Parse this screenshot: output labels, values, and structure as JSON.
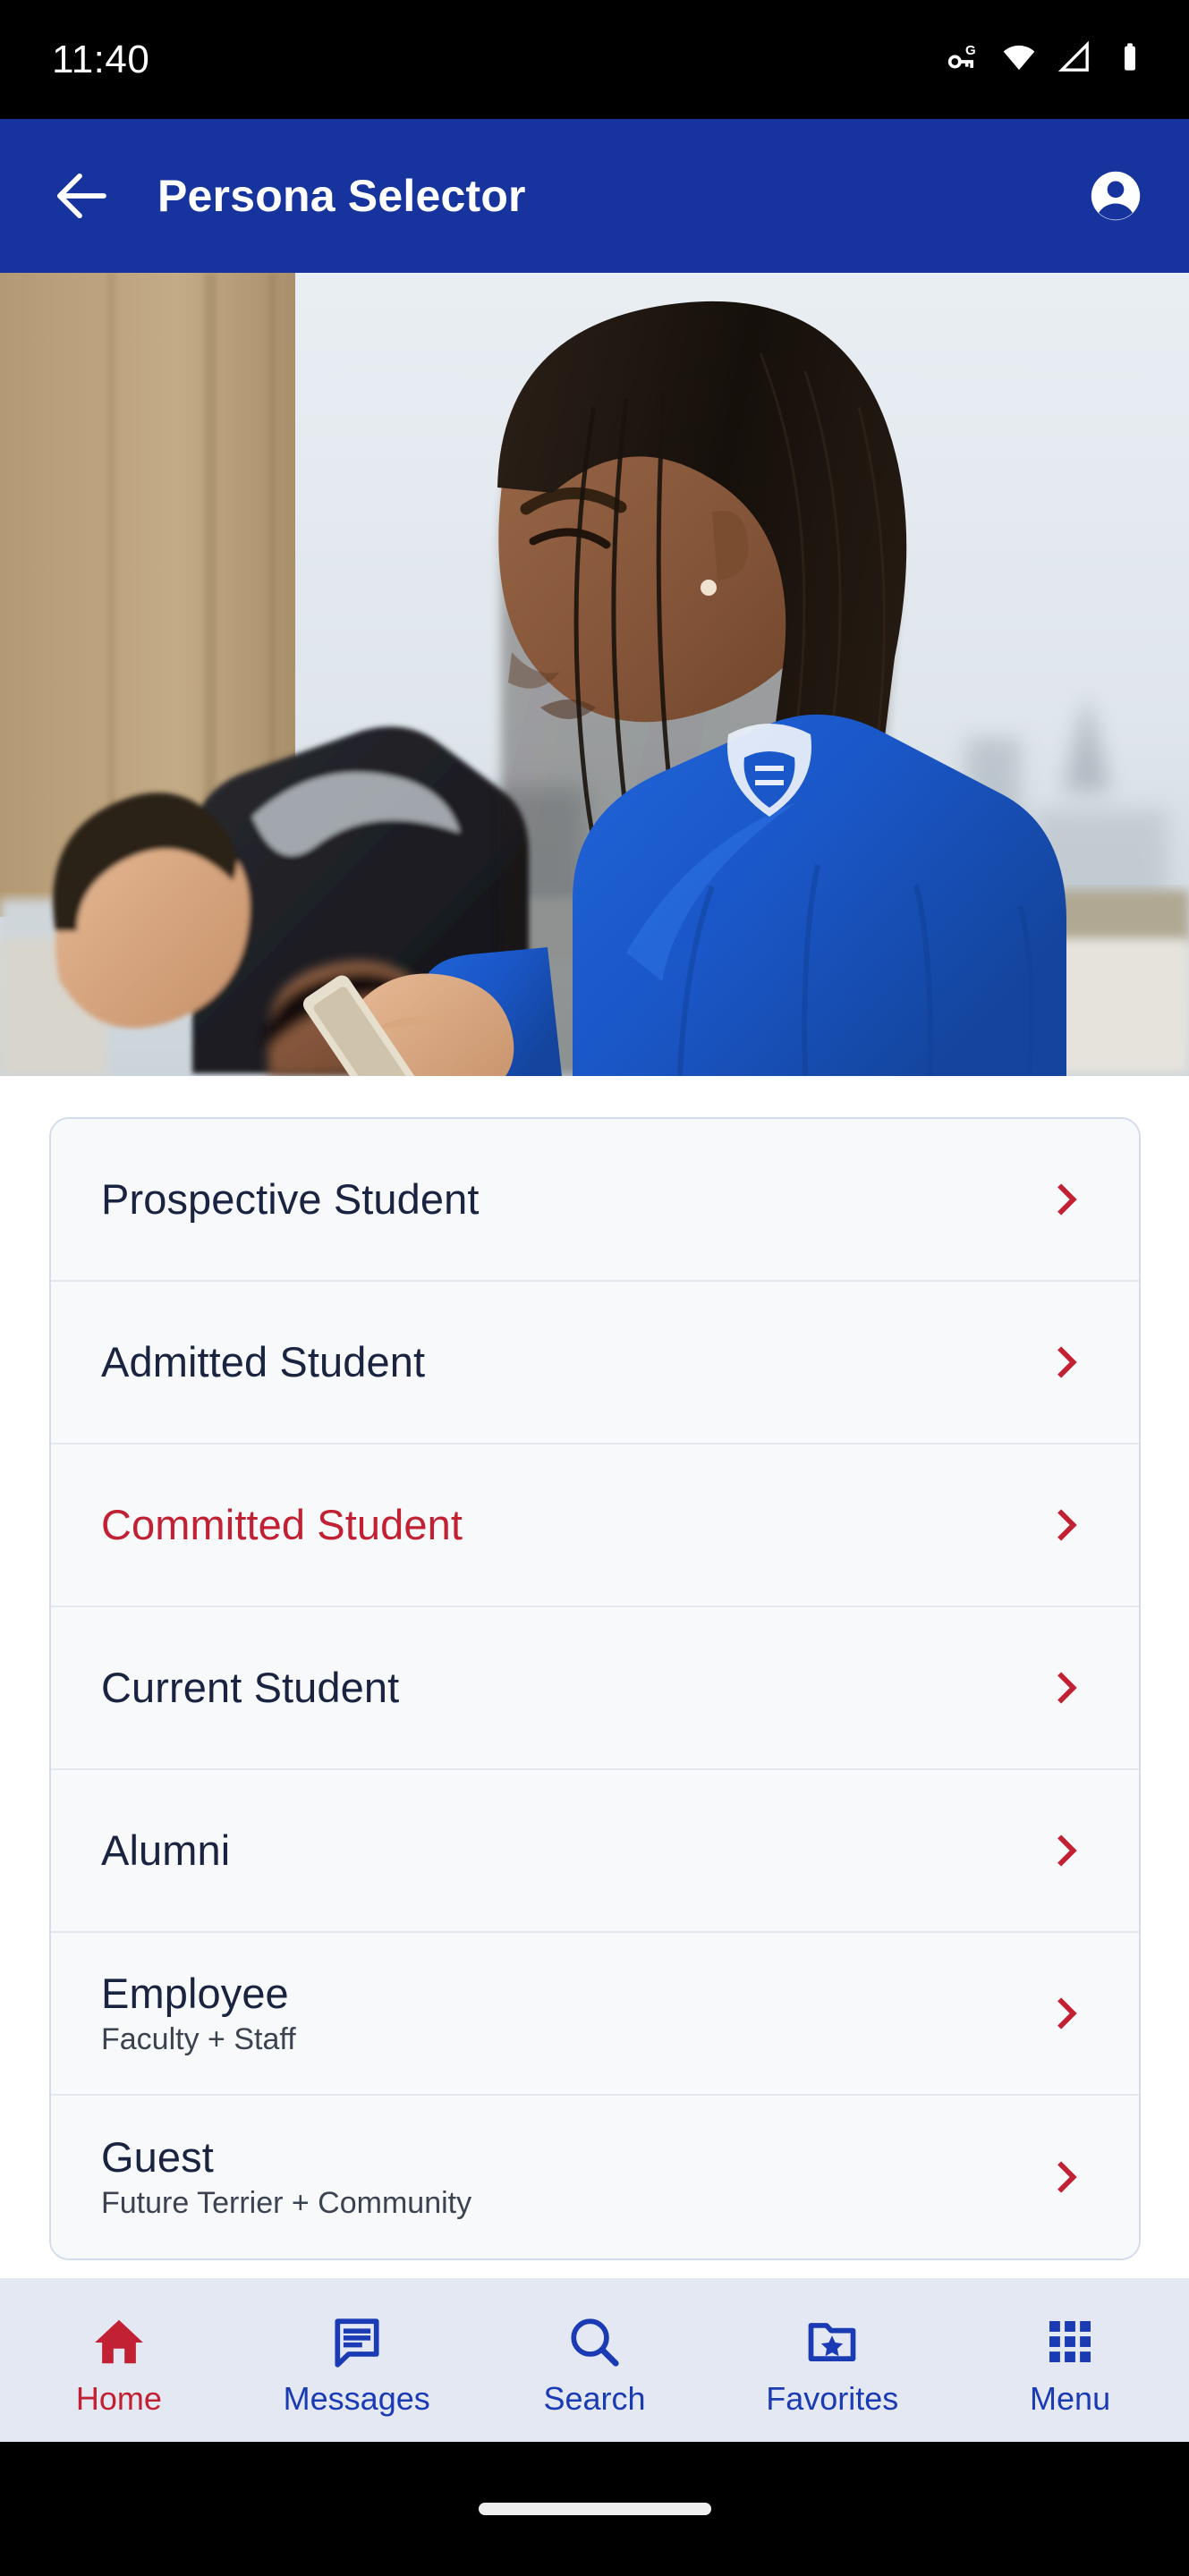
{
  "status_bar": {
    "time": "11:40",
    "icons": [
      "vpn-key-g-icon",
      "wifi-icon",
      "cellular-signal-icon",
      "battery-icon"
    ]
  },
  "app_bar": {
    "back_icon": "arrow-back-icon",
    "title": "Persona Selector",
    "account_icon": "account-circle-icon",
    "background_color": "#16339E",
    "text_color": "#FFFFFF"
  },
  "hero": {
    "alt": "Students outdoors on a rooftop looking at a phone, city skyline in background"
  },
  "personas": {
    "chevron_icon": "chevron-right-icon",
    "chevron_color": "#C22033",
    "active_color": "#C22033",
    "default_color": "#1A2340",
    "items": [
      {
        "title": "Prospective Student",
        "subtitle": "",
        "active": false
      },
      {
        "title": "Admitted Student",
        "subtitle": "",
        "active": false
      },
      {
        "title": "Committed Student",
        "subtitle": "",
        "active": true
      },
      {
        "title": "Current Student",
        "subtitle": "",
        "active": false
      },
      {
        "title": "Alumni",
        "subtitle": "",
        "active": false
      },
      {
        "title": "Employee",
        "subtitle": "Faculty + Staff",
        "active": false
      },
      {
        "title": "Guest",
        "subtitle": "Future Terrier + Community",
        "active": false
      }
    ]
  },
  "bottom_nav": {
    "background_color": "#E3E8F2",
    "inactive_color": "#1A3BB3",
    "active_color": "#C22033",
    "items": [
      {
        "label": "Home",
        "icon": "home-icon",
        "active": true
      },
      {
        "label": "Messages",
        "icon": "messages-icon",
        "active": false
      },
      {
        "label": "Search",
        "icon": "search-icon",
        "active": false
      },
      {
        "label": "Favorites",
        "icon": "favorites-folder-star-icon",
        "active": false
      },
      {
        "label": "Menu",
        "icon": "grid-menu-icon",
        "active": false
      }
    ]
  }
}
